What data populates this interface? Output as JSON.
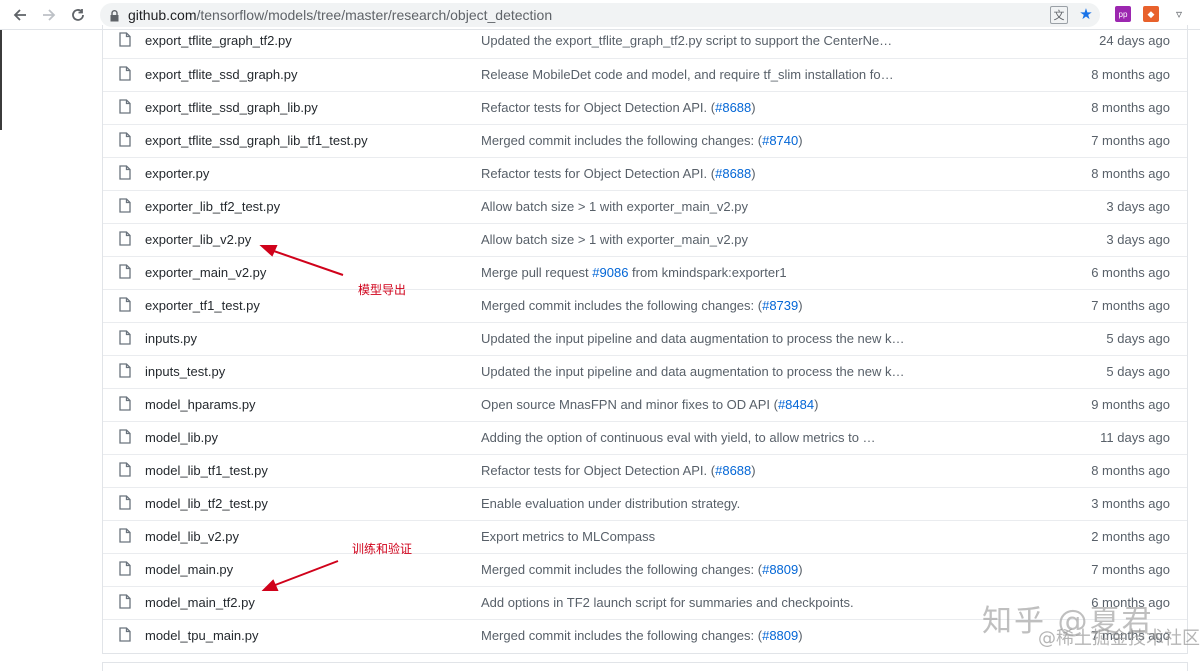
{
  "browser": {
    "url_host": "github.com",
    "url_path": "/tensorflow/models/tree/master/research/object_detection",
    "icons": [
      "back-icon",
      "forward-icon",
      "reload-icon",
      "lock-icon",
      "translate-icon",
      "star-icon",
      "extension-icon",
      "extension-icon",
      "extension-icon"
    ]
  },
  "files": [
    {
      "name": "export_tflite_graph_tf2.py",
      "message": "Updated the export_tflite_graph_tf2.py script to support the CenterNe…",
      "link": "",
      "suffix": "",
      "age": "24 days ago"
    },
    {
      "name": "export_tflite_ssd_graph.py",
      "message": "Release MobileDet code and model, and require tf_slim installation fo…",
      "link": "",
      "suffix": "",
      "age": "8 months ago"
    },
    {
      "name": "export_tflite_ssd_graph_lib.py",
      "message": "Refactor tests for Object Detection API. (",
      "link": "#8688",
      "suffix": ")",
      "age": "8 months ago"
    },
    {
      "name": "export_tflite_ssd_graph_lib_tf1_test.py",
      "message": "Merged commit includes the following changes: (",
      "link": "#8740",
      "suffix": ")",
      "age": "7 months ago"
    },
    {
      "name": "exporter.py",
      "message": "Refactor tests for Object Detection API. (",
      "link": "#8688",
      "suffix": ")",
      "age": "8 months ago"
    },
    {
      "name": "exporter_lib_tf2_test.py",
      "message": "Allow batch size > 1 with exporter_main_v2.py",
      "link": "",
      "suffix": "",
      "age": "3 days ago"
    },
    {
      "name": "exporter_lib_v2.py",
      "message": "Allow batch size > 1 with exporter_main_v2.py",
      "link": "",
      "suffix": "",
      "age": "3 days ago"
    },
    {
      "name": "exporter_main_v2.py",
      "message": "Merge pull request ",
      "link": "#9086",
      "suffix": " from kmindspark:exporter1",
      "age": "6 months ago"
    },
    {
      "name": "exporter_tf1_test.py",
      "message": "Merged commit includes the following changes: (",
      "link": "#8739",
      "suffix": ")",
      "age": "7 months ago"
    },
    {
      "name": "inputs.py",
      "message": "Updated the input pipeline and data augmentation to process the new k…",
      "link": "",
      "suffix": "",
      "age": "5 days ago"
    },
    {
      "name": "inputs_test.py",
      "message": "Updated the input pipeline and data augmentation to process the new k…",
      "link": "",
      "suffix": "",
      "age": "5 days ago"
    },
    {
      "name": "model_hparams.py",
      "message": "Open source MnasFPN and minor fixes to OD API (",
      "link": "#8484",
      "suffix": ")",
      "age": "9 months ago"
    },
    {
      "name": "model_lib.py",
      "message": "Adding the option of continuous eval with yield, to allow metrics to …",
      "link": "",
      "suffix": "",
      "age": "11 days ago"
    },
    {
      "name": "model_lib_tf1_test.py",
      "message": "Refactor tests for Object Detection API. (",
      "link": "#8688",
      "suffix": ")",
      "age": "8 months ago"
    },
    {
      "name": "model_lib_tf2_test.py",
      "message": "Enable evaluation under distribution strategy.",
      "link": "",
      "suffix": "",
      "age": "3 months ago"
    },
    {
      "name": "model_lib_v2.py",
      "message": "Export metrics to MLCompass",
      "link": "",
      "suffix": "",
      "age": "2 months ago"
    },
    {
      "name": "model_main.py",
      "message": "Merged commit includes the following changes: (",
      "link": "#8809",
      "suffix": ")",
      "age": "7 months ago"
    },
    {
      "name": "model_main_tf2.py",
      "message": "Add options in TF2 launch script for summaries and checkpoints.",
      "link": "",
      "suffix": "",
      "age": "6 months ago"
    },
    {
      "name": "model_tpu_main.py",
      "message": "Merged commit includes the following changes: (",
      "link": "#8809",
      "suffix": ")",
      "age": "7 months ago"
    }
  ],
  "annotations": {
    "export_label": "模型导出",
    "train_label": "训练和验证",
    "color": "#d0021b"
  },
  "watermark": {
    "line1": "知乎 @夏君",
    "line2": "@稀土掘金技术社区"
  },
  "colors": {
    "link": "#0366d6",
    "text": "#24292e",
    "muted": "#586069"
  }
}
